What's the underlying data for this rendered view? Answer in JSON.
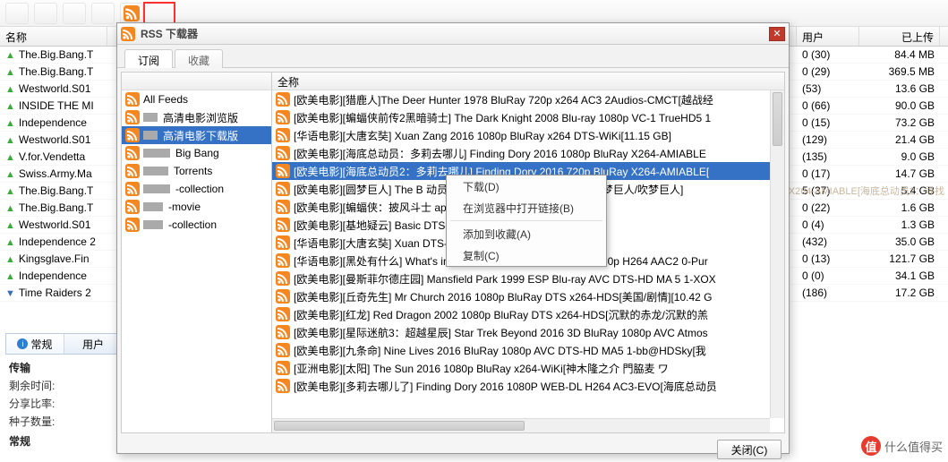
{
  "dialog": {
    "title": "RSS 下载器",
    "tabs": {
      "subscribe": "订阅",
      "favorites": "收藏"
    },
    "feed_header": "",
    "all_feeds": "All Feeds",
    "feeds": [
      {
        "label": "高清电影浏览版",
        "gray_w": 16
      },
      {
        "label": "高清电影下载版",
        "gray_w": 16,
        "selected": true
      },
      {
        "label": "Big Bang",
        "gray_w": 30
      },
      {
        "label": " Torrents",
        "gray_w": 28
      },
      {
        "label": "-collection",
        "gray_w": 30
      },
      {
        "label": "-movie",
        "gray_w": 22
      },
      {
        "label": "-collection",
        "gray_w": 22
      }
    ],
    "entry_header": "全称",
    "entries": [
      {
        "label": "[欧美电影][猎鹿人]The Deer Hunter 1978 BluRay 720p x264 AC3 2Audios-CMCT[越战经"
      },
      {
        "label": "[欧美电影][蝙蝠侠前传2黑暗骑士] The Dark Knight 2008 Blu-ray 1080p VC-1 TrueHD5 1"
      },
      {
        "label": "[华语电影][大唐玄奘] Xuan Zang 2016 1080p BluRay x264 DTS-WiKi[11.15 GB]"
      },
      {
        "label": "[欧美电影][海底总动员：多莉去哪儿] Finding Dory 2016 1080p BluRay X264-AMIABLE"
      },
      {
        "label": "[欧美电影][海底总动员2：多莉去哪儿] Finding Dory 2016 720p BluRay X264-AMIABLE[",
        "selected": true
      },
      {
        "label": "[欧美电影][圆梦巨人] The B                    动员2：多莉去哪儿] Fin AC3-EVO[圆梦巨人/吹梦巨人]"
      },
      {
        "label": "[欧美电影][蝙蝠侠：披风斗士                                    aped Crusaders 2016 1080p"
      },
      {
        "label": "[欧美电影][基地疑云] Basic                                    DTS-HD MA 6.1-DIY@miracle"
      },
      {
        "label": "[华语电影][大唐玄奘] Xuan                                    DTS-HDChina[*冲奥啦* 请当成"
      },
      {
        "label": "[华语电影][黑处有什么] What's in the Darkness 2016 WEB-DL 2160p H264 AAC2 0-Pur"
      },
      {
        "label": "[欧美电影][曼斯菲尔德庄园] Mansfield Park 1999 ESP Blu-ray AVC DTS-HD MA 5 1-XOX"
      },
      {
        "label": "[欧美电影][丘奇先生] Mr Church 2016 1080p BluRay DTS x264-HDS[美国/剧情][10.42 G"
      },
      {
        "label": "[欧美电影][红龙] Red Dragon 2002 1080p BluRay DTS x264-HDS[沉默的赤龙/沉默的羔"
      },
      {
        "label": "[欧美电影][星际迷航3：超越星辰] Star Trek Beyond 2016 3D BluRay 1080p AVC Atmos"
      },
      {
        "label": "[欧美电影][九条命] Nine Lives 2016 BluRay 1080p AVC DTS-HD MA5 1-bb@HDSky[我"
      },
      {
        "label": "[亚洲电影][太阳] The Sun 2016 1080p BluRay x264-WiKi[神木隆之介 門脇麦  ワ"
      },
      {
        "label": "[欧美电影][多莉去哪儿了] Finding Dory 2016 1080P WEB-DL H264 AC3-EVO[海底总动员"
      }
    ],
    "close_btn": "关闭(C)"
  },
  "context_menu": {
    "download": "下载(D)",
    "open_browser": "在浏览器中打开链接(B)",
    "add_fav": "添加到收藏(A)",
    "copy": "复制(C)"
  },
  "bg_headers": {
    "name": "名称",
    "user": "用户",
    "uploaded": "已上传"
  },
  "bg_rows": [
    {
      "arrow": "up",
      "name": "The.Big.Bang.T",
      "user": "0 (30)",
      "uploaded": "84.4 MB"
    },
    {
      "arrow": "up",
      "name": "The.Big.Bang.T",
      "user": "0 (29)",
      "uploaded": "369.5 MB"
    },
    {
      "arrow": "up",
      "name": "Westworld.S01",
      "user": "  (53)",
      "uploaded": "13.6 GB"
    },
    {
      "arrow": "up",
      "name": "INSIDE THE MI",
      "user": "0 (66)",
      "uploaded": "90.0 GB"
    },
    {
      "arrow": "up",
      "name": "Independence",
      "user": "0 (15)",
      "uploaded": "73.2 GB"
    },
    {
      "arrow": "up",
      "name": "Westworld.S01",
      "user": "  (129)",
      "uploaded": "21.4 GB"
    },
    {
      "arrow": "up",
      "name": "V.for.Vendetta",
      "user": "  (135)",
      "uploaded": "9.0 GB"
    },
    {
      "arrow": "up",
      "name": "Swiss.Army.Ma",
      "user": "0 (17)",
      "uploaded": "14.7 GB"
    },
    {
      "arrow": "up",
      "name": "The.Big.Bang.T",
      "user": "5 (37)",
      "uploaded": "5.4 GB"
    },
    {
      "arrow": "up",
      "name": "The.Big.Bang.T",
      "user": "0 (22)",
      "uploaded": "1.6 GB"
    },
    {
      "arrow": "up",
      "name": "Westworld.S01",
      "user": "0 (4)",
      "uploaded": "1.3 GB"
    },
    {
      "arrow": "up",
      "name": "Independence 2",
      "user": "  (432)",
      "uploaded": "35.0 GB"
    },
    {
      "arrow": "up",
      "name": "Kingsglave.Fin",
      "user": "0 (13)",
      "uploaded": "121.7 GB"
    },
    {
      "arrow": "up",
      "name": "Independence",
      "user": "0 (0)",
      "uploaded": "34.1 GB"
    },
    {
      "arrow": "down",
      "name": "Time Raiders 2",
      "user": "  (186)",
      "uploaded": "17.2 GB"
    }
  ],
  "side_tabs": {
    "general": "常规",
    "user": "用户"
  },
  "section_transfer": "传输",
  "stats": {
    "eta_label": "剩余时间:",
    "share_label": "分享比率:",
    "seed_label": "种子数量:"
  },
  "section_general": "常规",
  "watermark_text": "什么值得买",
  "watermark_badge": "值",
  "detail_overlay_text": "X264-AMIABLE[海底总动员2：寻找"
}
